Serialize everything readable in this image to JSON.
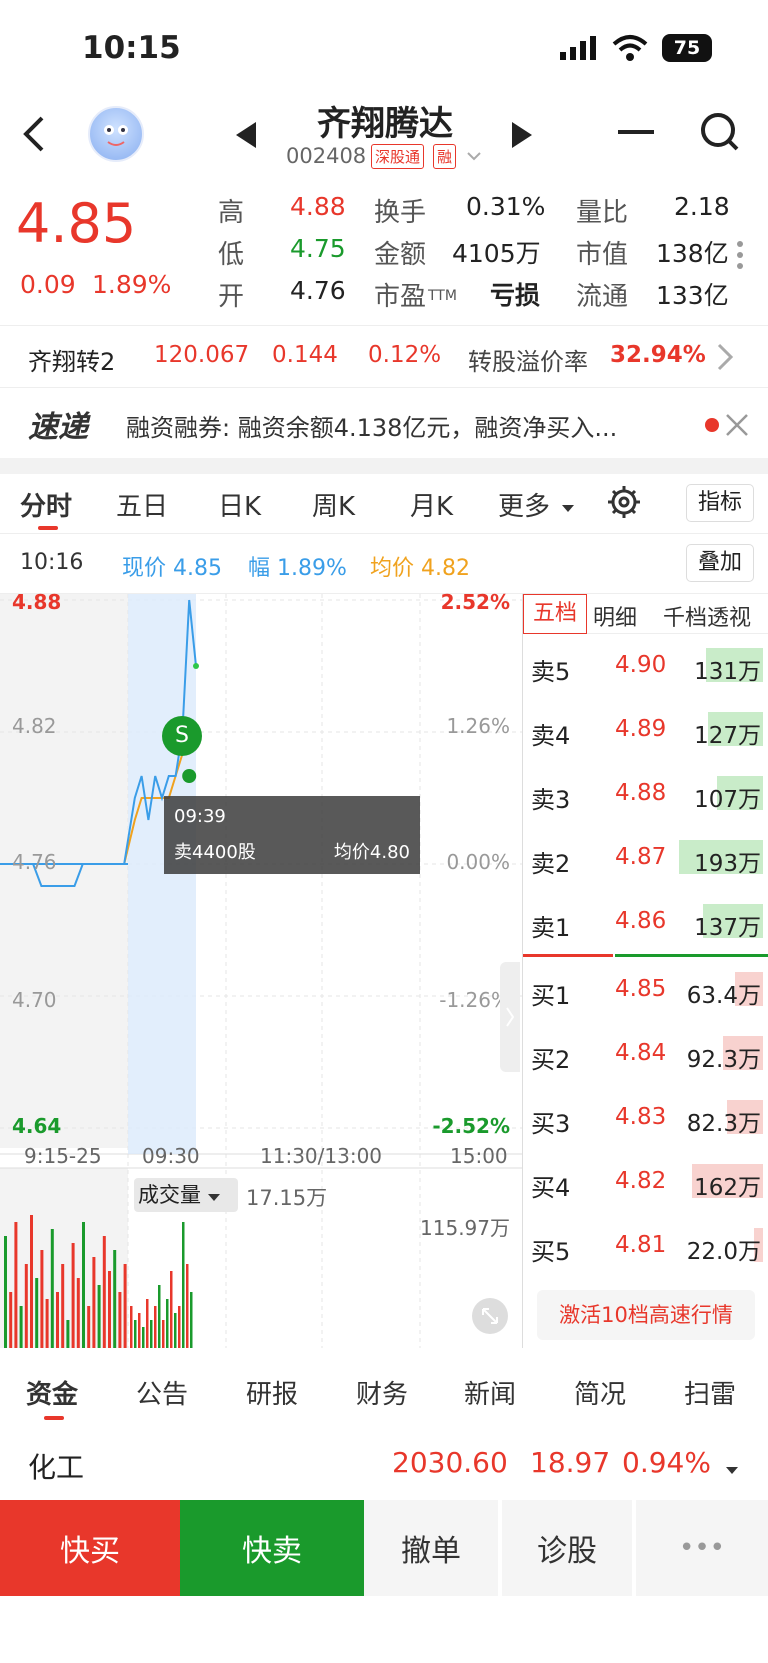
{
  "status": {
    "time": "10:15",
    "battery": "75"
  },
  "header": {
    "name": "齐翔腾达",
    "code": "002408",
    "tag1": "深股通",
    "tag2": "融"
  },
  "quote": {
    "price": "4.85",
    "change": "0.09",
    "pct": "1.89%",
    "high_label": "高",
    "high": "4.88",
    "low_label": "低",
    "low": "4.75",
    "open_label": "开",
    "open": "4.76",
    "turnover_label": "换手",
    "turnover": "0.31%",
    "amount_label": "金额",
    "amount": "4105万",
    "pe_label": "市盈",
    "pe_sub": "TTM",
    "pe": "亏损",
    "vr_label": "量比",
    "vr": "2.18",
    "mcap_label": "市值",
    "mcap": "138亿",
    "float_label": "流通",
    "float": "133亿"
  },
  "convertible": {
    "name": "齐翔转2",
    "price": "120.067",
    "change": "0.144",
    "pct": "0.12%",
    "premium_label": "转股溢价率",
    "premium": "32.94%"
  },
  "news": {
    "badge": "速递",
    "text": "融资融券: 融资余额4.138亿元，融资净买入..."
  },
  "tabs": {
    "items": [
      "分时",
      "五日",
      "日K",
      "周K",
      "月K",
      "更多"
    ],
    "indicator": "指标"
  },
  "info": {
    "time": "10:16",
    "now": "现价 4.85",
    "amp": "幅 1.89%",
    "avg": "均价 4.82",
    "overlay": "叠加"
  },
  "chart": {
    "y_left": [
      "4.88",
      "4.82",
      "4.76",
      "4.70",
      "4.64"
    ],
    "y_right": [
      "2.52%",
      "1.26%",
      "0.00%",
      "-1.26%",
      "-2.52%"
    ],
    "x_labels": [
      "9:15-25",
      "09:30",
      "11:30/13:00",
      "15:00"
    ],
    "marker": "S",
    "tooltip": {
      "time": "09:39",
      "text": "卖4400股",
      "avg": "均价4.80"
    },
    "volume_label": "成交量",
    "volume_value": "17.15万",
    "volume_max": "115.97万"
  },
  "chart_data": {
    "type": "line",
    "title": "",
    "ylim": [
      4.64,
      4.88
    ],
    "series": [
      {
        "name": "现价",
        "x": [
          "09:15",
          "09:19",
          "09:20",
          "09:24",
          "09:25",
          "09:30",
          "09:31",
          "09:32",
          "09:33",
          "09:34",
          "09:35",
          "09:36",
          "09:37",
          "09:38",
          "09:39",
          "09:40"
        ],
        "values": [
          4.76,
          4.76,
          4.75,
          4.75,
          4.76,
          4.76,
          4.79,
          4.8,
          4.78,
          4.8,
          4.79,
          4.8,
          4.8,
          4.82,
          4.88,
          4.85
        ]
      },
      {
        "name": "均价",
        "x": [
          "09:25",
          "09:30",
          "09:31",
          "09:32",
          "09:35",
          "09:36",
          "09:37",
          "09:38",
          "09:39",
          "09:40"
        ],
        "values": [
          4.76,
          4.76,
          4.78,
          4.79,
          4.79,
          4.79,
          4.8,
          4.81,
          4.82,
          4.82
        ]
      }
    ]
  },
  "orderbook": {
    "tabs": [
      "五档",
      "明细",
      "千档透视"
    ],
    "asks": [
      {
        "label": "卖5",
        "price": "4.90",
        "vol": "131万",
        "w": 0.68
      },
      {
        "label": "卖4",
        "price": "4.89",
        "vol": "127万",
        "w": 0.66
      },
      {
        "label": "卖3",
        "price": "4.88",
        "vol": "107万",
        "w": 0.55
      },
      {
        "label": "卖2",
        "price": "4.87",
        "vol": "193万",
        "w": 1.0
      },
      {
        "label": "卖1",
        "price": "4.86",
        "vol": "137万",
        "w": 0.71
      }
    ],
    "bids": [
      {
        "label": "买1",
        "price": "4.85",
        "vol": "63.4万",
        "w": 0.33
      },
      {
        "label": "买2",
        "price": "4.84",
        "vol": "92.3万",
        "w": 0.48
      },
      {
        "label": "买3",
        "price": "4.83",
        "vol": "82.3万",
        "w": 0.43
      },
      {
        "label": "买4",
        "price": "4.82",
        "vol": "162万",
        "w": 0.84
      },
      {
        "label": "买5",
        "price": "4.81",
        "vol": "22.0万",
        "w": 0.11
      }
    ],
    "activate": "激活10档高速行情"
  },
  "bottomtabs": [
    "资金",
    "公告",
    "研报",
    "财务",
    "新闻",
    "简况",
    "扫雷"
  ],
  "sector": {
    "name": "化工",
    "value": "2030.60",
    "change": "18.97",
    "pct": "0.94%"
  },
  "actions": [
    "快买",
    "快卖",
    "撤单",
    "诊股",
    "•••"
  ]
}
